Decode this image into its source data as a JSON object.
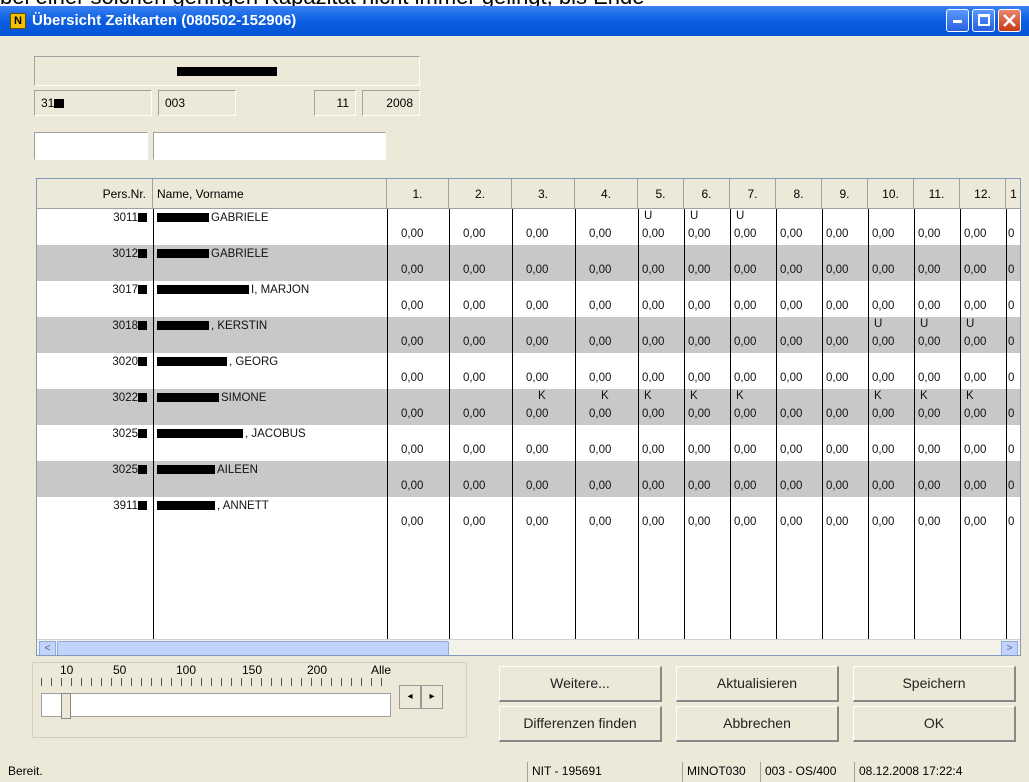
{
  "window": {
    "title": "Übersicht Zeitkarten (080502-152906)"
  },
  "header": {
    "pers_prefix": "31",
    "code": "003",
    "month": "11",
    "year": "2008"
  },
  "grid": {
    "columns": {
      "pers_nr": "Pers.Nr.",
      "name": "Name, Vorname",
      "days": [
        "1.",
        "2.",
        "3.",
        "4.",
        "5.",
        "6.",
        "7.",
        "8.",
        "9.",
        "10.",
        "11.",
        "12.",
        "1"
      ]
    },
    "rows": [
      {
        "pers": "3011",
        "name": "GABRIELE",
        "name_prefix": "",
        "marks": [
          "",
          "",
          "",
          "",
          "U",
          "U",
          "U",
          "",
          "",
          "",
          "",
          ""
        ],
        "values": [
          "0,00",
          "0,00",
          "0,00",
          "0,00",
          "0,00",
          "0,00",
          "0,00",
          "0,00",
          "0,00",
          "0,00",
          "0,00",
          "0,00"
        ],
        "last": "0"
      },
      {
        "pers": "3012",
        "name": "GABRIELE",
        "name_prefix": "",
        "marks": [
          "",
          "",
          "",
          "",
          "",
          "",
          "",
          "",
          "",
          "",
          "",
          ""
        ],
        "values": [
          "0,00",
          "0,00",
          "0,00",
          "0,00",
          "0,00",
          "0,00",
          "0,00",
          "0,00",
          "0,00",
          "0,00",
          "0,00",
          "0,00"
        ],
        "last": "0"
      },
      {
        "pers": "3017",
        "name": "I, MARJON",
        "name_prefix": "",
        "marks": [
          "",
          "",
          "",
          "",
          "",
          "",
          "",
          "",
          "",
          "",
          "",
          ""
        ],
        "values": [
          "0,00",
          "0,00",
          "0,00",
          "0,00",
          "0,00",
          "0,00",
          "0,00",
          "0,00",
          "0,00",
          "0,00",
          "0,00",
          "0,00"
        ],
        "last": "0"
      },
      {
        "pers": "3018",
        "name": ", KERSTIN",
        "name_prefix": "",
        "marks": [
          "",
          "",
          "",
          "",
          "",
          "",
          "",
          "",
          "",
          "U",
          "U",
          "U"
        ],
        "values": [
          "0,00",
          "0,00",
          "0,00",
          "0,00",
          "0,00",
          "0,00",
          "0,00",
          "0,00",
          "0,00",
          "0,00",
          "0,00",
          "0,00"
        ],
        "last": "0"
      },
      {
        "pers": "3020",
        "name": ", GEORG",
        "name_prefix": "",
        "marks": [
          "",
          "",
          "",
          "",
          "",
          "",
          "",
          "",
          "",
          "",
          "",
          ""
        ],
        "values": [
          "0,00",
          "0,00",
          "0,00",
          "0,00",
          "0,00",
          "0,00",
          "0,00",
          "0,00",
          "0,00",
          "0,00",
          "0,00",
          "0,00"
        ],
        "last": "0"
      },
      {
        "pers": "3022",
        "name": "SIMONE",
        "name_prefix": "",
        "marks": [
          "",
          "",
          "K",
          "K",
          "K",
          "K",
          "K",
          "",
          "",
          "K",
          "K",
          "K"
        ],
        "values": [
          "0,00",
          "0,00",
          "0,00",
          "0,00",
          "0,00",
          "0,00",
          "0,00",
          "0,00",
          "0,00",
          "0,00",
          "0,00",
          "0,00"
        ],
        "last": "0"
      },
      {
        "pers": "3025",
        "name": ", JACOBUS",
        "name_prefix": "",
        "marks": [
          "",
          "",
          "",
          "",
          "",
          "",
          "",
          "",
          "",
          "",
          "",
          ""
        ],
        "values": [
          "0,00",
          "0,00",
          "0,00",
          "0,00",
          "0,00",
          "0,00",
          "0,00",
          "0,00",
          "0,00",
          "0,00",
          "0,00",
          "0,00"
        ],
        "last": "0"
      },
      {
        "pers": "3025",
        "name": "AILEEN",
        "name_prefix": "",
        "marks": [
          "",
          "",
          "",
          "",
          "",
          "",
          "",
          "",
          "",
          "",
          "",
          ""
        ],
        "values": [
          "0,00",
          "0,00",
          "0,00",
          "0,00",
          "0,00",
          "0,00",
          "0,00",
          "0,00",
          "0,00",
          "0,00",
          "0,00",
          "0,00"
        ],
        "last": "0"
      },
      {
        "pers": "3911",
        "name": ", ANNETT",
        "name_prefix": "",
        "marks": [
          "",
          "",
          "",
          "",
          "",
          "",
          "",
          "",
          "",
          "",
          "",
          ""
        ],
        "values": [
          "0,00",
          "0,00",
          "0,00",
          "0,00",
          "0,00",
          "0,00",
          "0,00",
          "0,00",
          "0,00",
          "0,00",
          "0,00",
          "0,00"
        ],
        "last": "0"
      }
    ]
  },
  "scrollbar": {
    "left_arrow": "<",
    "right_arrow": ">"
  },
  "slider": {
    "labels": [
      "10",
      "50",
      "100",
      "150",
      "200",
      "Alle"
    ]
  },
  "buttons": {
    "weitere": "Weitere...",
    "aktualisieren": "Aktualisieren",
    "speichern": "Speichern",
    "differenzen": "Differenzen finden",
    "abbrechen": "Abbrechen",
    "ok": "OK"
  },
  "status": {
    "ready": "Bereit.",
    "nit": "NIT - 195691",
    "user": "MINOT030",
    "system": "003 - OS/400",
    "datetime": "08.12.2008 17:22:4"
  }
}
